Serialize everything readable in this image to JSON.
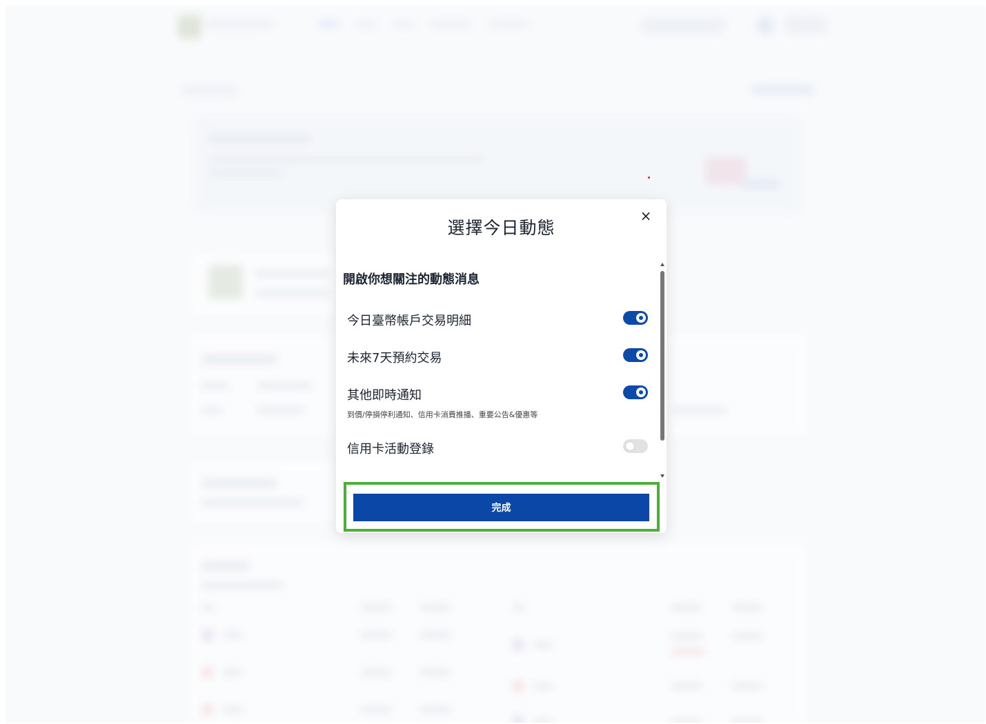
{
  "modal": {
    "title": "選擇今日動態",
    "close_glyph": "×",
    "section_title": "開啟你想關注的動態消息",
    "options": [
      {
        "label": "今日臺幣帳戶交易明細",
        "subtitle": "",
        "enabled": true
      },
      {
        "label": "未來7天預約交易",
        "subtitle": "",
        "enabled": true
      },
      {
        "label": "其他即時通知",
        "subtitle": "到價/停損停利通知、信用卡消費推播、重要公告&優惠等",
        "enabled": true
      },
      {
        "label": "信用卡活動登錄",
        "subtitle": "",
        "enabled": false
      }
    ],
    "done_label": "完成"
  },
  "colors": {
    "toggle_on": "#0b4aa8",
    "toggle_off": "#e2e2e2",
    "done_button": "#0b47a6",
    "highlight": "#4caf3a"
  }
}
